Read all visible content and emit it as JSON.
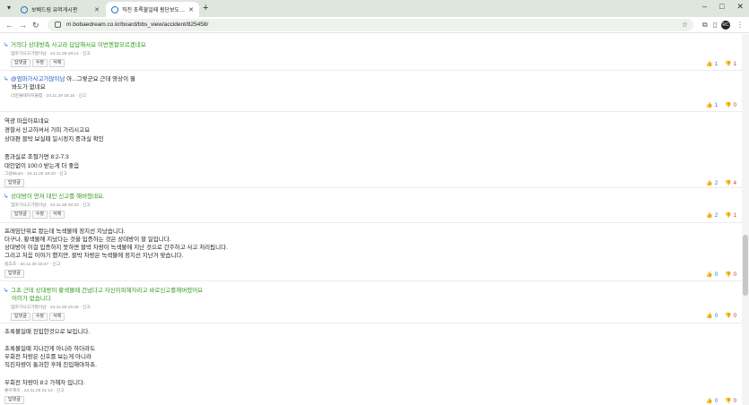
{
  "browser": {
    "tabs": [
      {
        "title": "보배드림 유머게시판",
        "active": false
      },
      {
        "title": "직진 초록불일때 횡단보도를 지나가는 중",
        "active": true
      }
    ],
    "url": "m.bobaedream.co.kr/board/bbs_view/accident/825458/",
    "profile_initials": "RC"
  },
  "comments": [
    {
      "reply": true,
      "lines": [
        {
          "text": "거의다 상대방측 사고라 답답해서요 이번엔잘모르겠네요",
          "style": "green"
        }
      ],
      "meta": "엄마가사고가많이남 · 24.11.29 18:14 · 신고",
      "buttons": [
        "답댓글",
        "수정",
        "삭제"
      ],
      "up": "1",
      "down": "1"
    },
    {
      "reply": true,
      "mention": "@엄마가사고가많이남",
      "lines": [
        {
          "text": " 아...그렇군요 근데 영상이 뭘",
          "style": "normal"
        },
        {
          "text": "봐도가 없네요",
          "style": "normal"
        }
      ],
      "meta": "너만볼때까지볼렵 · 24.11.29 18:15 · 신고",
      "buttons": [],
      "up": "1",
      "down": "0"
    },
    {
      "reply": false,
      "lines": [
        {
          "text": "역광 마음아프네요",
          "style": "normal"
        },
        {
          "text": "경찰서 신고하셔서 가피 가리시고요",
          "style": "normal"
        },
        {
          "text": "상대편 블박 보실때 일시정지 중과실 확인",
          "style": "normal"
        },
        {
          "text": "",
          "style": "normal"
        },
        {
          "text": "중과실로 조절가면 8:2-7:3",
          "style": "normal"
        },
        {
          "text": "대인없이 100:0 받는게 더 좋음",
          "style": "normal"
        }
      ],
      "meta": "그냥Blues · 24.11.29 18:20 · 신고",
      "buttons": [
        "답댓글"
      ],
      "up": "2",
      "down": "4"
    },
    {
      "reply": true,
      "lines": [
        {
          "text": "상대방이 먼저 대인 신고를 해버렸네요.",
          "style": "green"
        }
      ],
      "meta": "엄마가사고가많이남 · 24.11.29 18:23 · 신고",
      "buttons": [
        "답댓글",
        "수정",
        "삭제"
      ],
      "up": "2",
      "down": "1"
    },
    {
      "reply": false,
      "lines": [
        {
          "text": "프레임단위로 봤는데 녹색불에 정지선 지났습니다.",
          "style": "normal"
        },
        {
          "text": "더구나, 황색불에 지났다는 것을 입증하는 것은 상대방이 할 일입니다.",
          "style": "normal"
        },
        {
          "text": "상대방이 이걸 입증하지 못하면 블박 차량이 녹색불에 지난 것으로 간주하고 사고 처리됩니다.",
          "style": "normal"
        },
        {
          "text": "그리고 처음 이야기 했지만, 블박 차량은 녹색불에 정지선 지난거 맞습니다.",
          "style": "normal"
        }
      ],
      "meta": "킬조츠 · 24.11.29 18:47 · 신고",
      "buttons": [
        "답댓글"
      ],
      "up": "0",
      "down": "0"
    },
    {
      "reply": true,
      "lines": [
        {
          "text": "그죠 근데 상대방이 황색불때 건넜다고 자신이피해자라고 바로신고를해버렸어요",
          "style": "green"
        },
        {
          "text": "어이가 없습니다",
          "style": "green"
        }
      ],
      "meta": "엄마가사고가많이남 · 24.11.29 19:49 · 신고",
      "buttons": [
        "답댓글",
        "수정",
        "삭제"
      ],
      "up": "0",
      "down": "0"
    },
    {
      "reply": false,
      "lines": [
        {
          "text": "초록불일때 진입한것으로 보입니다.",
          "style": "normal"
        },
        {
          "text": "",
          "style": "normal"
        },
        {
          "text": "초록불일때 지나간게 아니라 하더라도",
          "style": "normal"
        },
        {
          "text": "우회전 차량은 신호를 보는게 아니라",
          "style": "normal"
        },
        {
          "text": "직진차량이 통과한 후에 진입해야하죠.",
          "style": "normal"
        },
        {
          "text": "",
          "style": "normal"
        },
        {
          "text": "우회전 차량이 8:2 가해자 입니다.",
          "style": "normal"
        }
      ],
      "meta": "좋아해지 · 24.11.29 21:13 · 신고",
      "buttons": [
        "답댓글"
      ],
      "up": "0",
      "down": "0"
    }
  ]
}
